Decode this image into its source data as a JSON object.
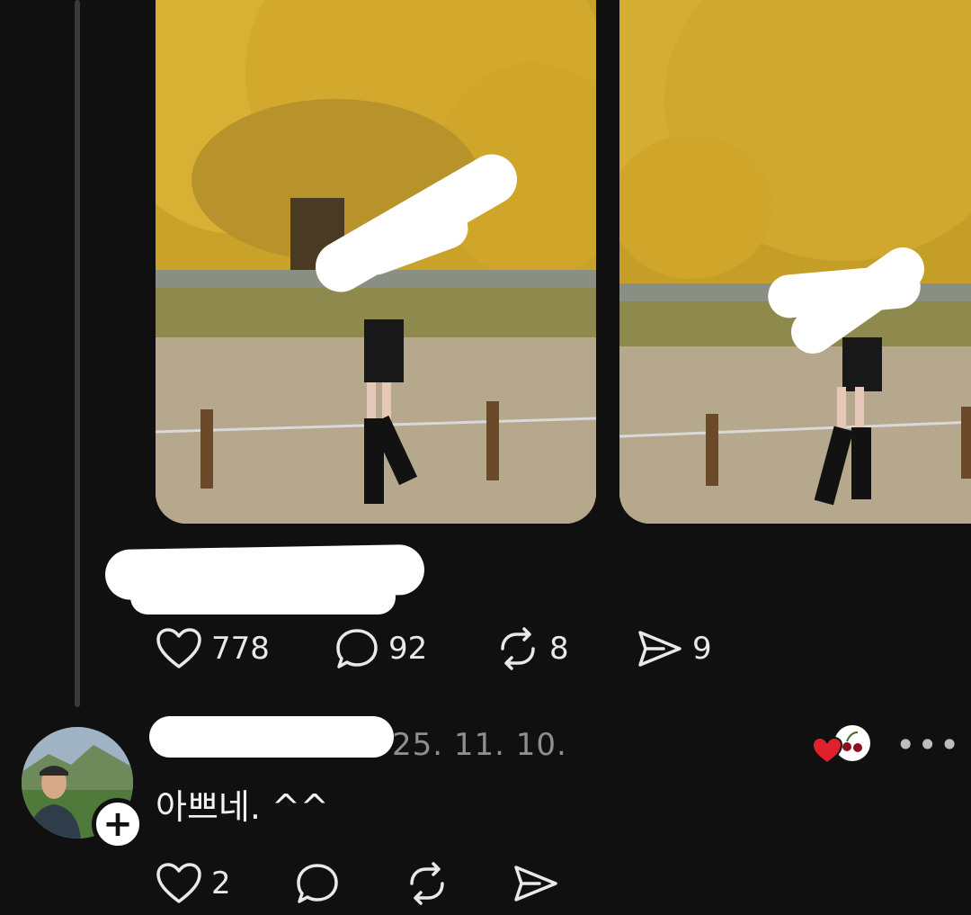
{
  "post": {
    "likes": "778",
    "comments": "92",
    "reposts": "8",
    "shares": "9"
  },
  "reply": {
    "date": "25. 11. 10.",
    "text": "아쁘네. ^^",
    "likes": "2",
    "follow_symbol": "+",
    "more_symbol": "•••"
  },
  "icons": {
    "like": "heart-icon",
    "comment": "comment-bubble-icon",
    "repost": "repost-icon",
    "share": "send-icon",
    "badge": "cherry-heart-badge-icon"
  },
  "colors": {
    "background": "#101010",
    "text": "#f3f3f3",
    "muted": "#8f8f8f",
    "heart": "#e0202a"
  }
}
